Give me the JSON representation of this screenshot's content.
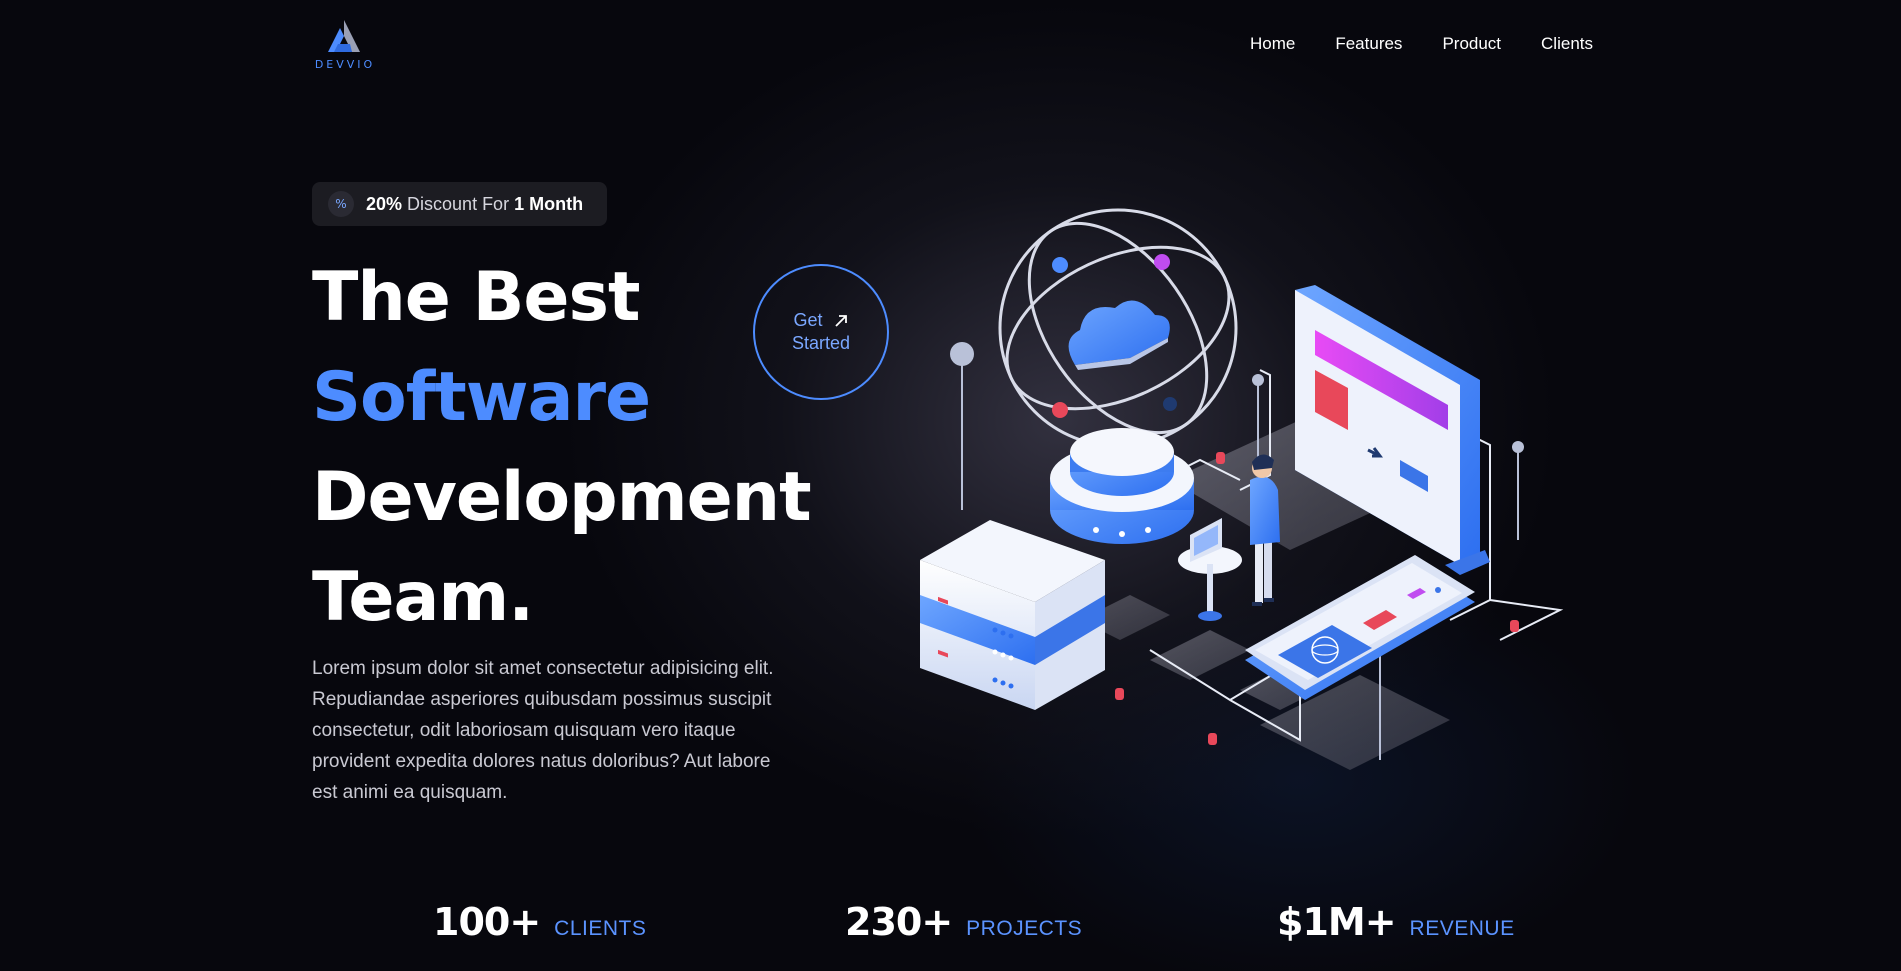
{
  "brand": {
    "name": "DEVVIO",
    "accent": "#4d8cff"
  },
  "nav": {
    "links": [
      "Home",
      "Features",
      "Product",
      "Clients"
    ]
  },
  "badge": {
    "icon": "percent-icon",
    "highlight1": "20%",
    "middle": " Discount For ",
    "highlight2": "1 Month"
  },
  "hero": {
    "title_line1": "The Best",
    "title_line2": "Software",
    "title_line3": "Development",
    "title_line4": "Team.",
    "description": "Lorem ipsum dolor sit amet consectetur adipisicing elit. Repudiandae asperiores quibusdam possimus suscipit consectetur, odit laboriosam quisquam vero itaque provident expedita dolores natus doloribus? Aut labore est animi ea quisquam.",
    "cta_line1": "Get",
    "cta_line2": "Started",
    "cta_icon": "arrow-up-right-icon"
  },
  "stats": [
    {
      "number": "100+",
      "label": "CLIENTS"
    },
    {
      "number": "230+",
      "label": "PROJECTS"
    },
    {
      "number": "$1M+",
      "label": "REVENUE"
    }
  ]
}
